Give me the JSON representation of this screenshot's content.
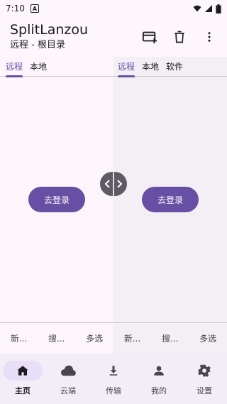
{
  "status_bar": {
    "time": "7:10",
    "notification_glyph": "A"
  },
  "app_bar": {
    "title": "SplitLanzou",
    "subtitle": "远程 - 根目录",
    "actions": [
      "new-card-icon",
      "delete-icon",
      "more-vert-icon"
    ]
  },
  "left_pane": {
    "tabs": [
      "远程",
      "本地"
    ],
    "active_tab": "远程",
    "login_label": "去登录",
    "footer": [
      "新...",
      "搜...",
      "多选"
    ]
  },
  "right_pane": {
    "tabs": [
      "远程",
      "本地",
      "软件"
    ],
    "active_tab": "远程",
    "login_label": "去登录",
    "footer": [
      "新...",
      "搜...",
      "多选"
    ]
  },
  "bottom_nav": [
    {
      "label": "主页",
      "icon": "home-icon",
      "active": true
    },
    {
      "label": "云端",
      "icon": "cloud-icon",
      "active": false
    },
    {
      "label": "传输",
      "icon": "download-icon",
      "active": false
    },
    {
      "label": "我的",
      "icon": "person-icon",
      "active": false
    },
    {
      "label": "设置",
      "icon": "gear-icon",
      "active": false
    }
  ],
  "colors": {
    "accent": "#6750a4",
    "nav_bg": "#f3edf7",
    "active_pill": "#e8def8"
  }
}
